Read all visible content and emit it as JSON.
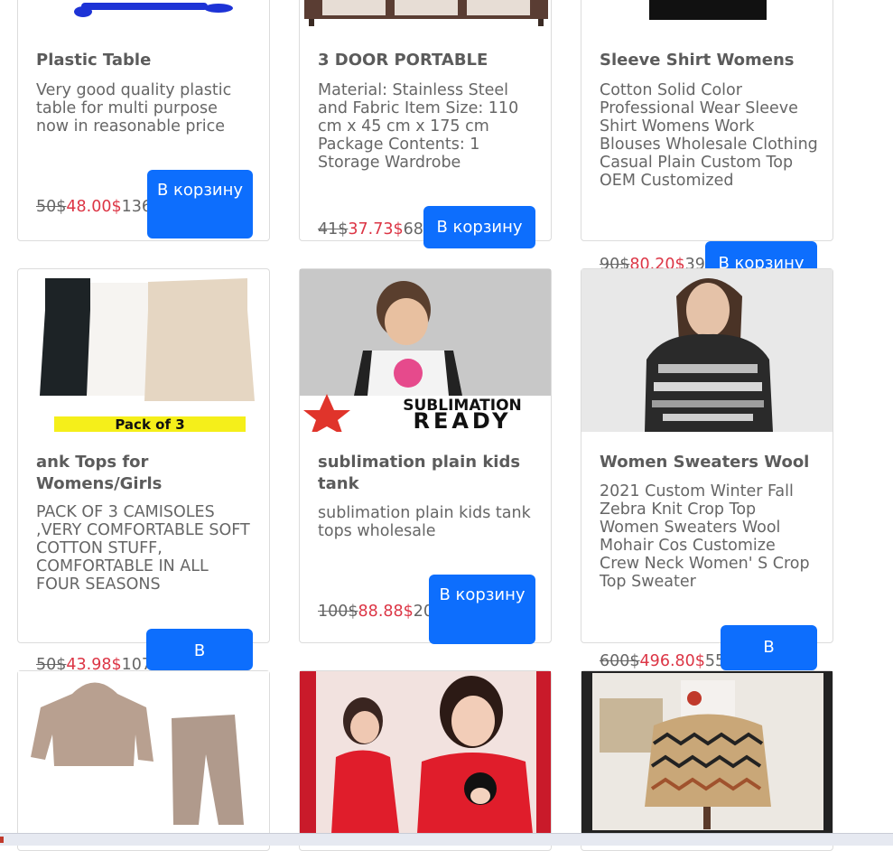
{
  "colors": {
    "accent": "#0d6efd",
    "sale": "#dc3545"
  },
  "products": [
    {
      "title": "Plastic Table",
      "description": "Very good quality plastic table for multi purpose now in reasonable price",
      "old_price": "50$",
      "new_price": "48.00$",
      "qty": "136",
      "button": "В корзину"
    },
    {
      "title": "3 DOOR PORTABLE",
      "description": "Material: Stainless Steel and Fabric Item Size: 110 cm x 45 cm x 175 cm Package Contents: 1 Storage Wardrobe",
      "old_price": "41$",
      "new_price": "37.73$",
      "qty": "68",
      "button": "В корзину"
    },
    {
      "title": "Sleeve Shirt Womens",
      "description": "Cotton Solid Color Professional Wear Sleeve Shirt Womens Work Blouses Wholesale Clothing Casual Plain Custom Top OEM Customized",
      "old_price": "90$",
      "new_price": "80.20$",
      "qty": "39",
      "button": "В корзину"
    },
    {
      "title": "ank Tops for Womens/Girls",
      "description": "PACK OF 3 CAMISOLES ,VERY COMFORTABLE SOFT COTTON STUFF, COMFORTABLE IN ALL FOUR SEASONS",
      "old_price": "50$",
      "new_price": "43.98$",
      "qty": "107",
      "button": "В",
      "image_caption": "Pack of 3"
    },
    {
      "title": "sublimation plain kids tank",
      "description": "sublimation plain kids tank tops wholesale",
      "old_price": "100$",
      "new_price": "88.88$",
      "qty": "20",
      "button": "В корзину",
      "image_caption": "SUBLIMATION",
      "image_caption2": "READY"
    },
    {
      "title": "Women Sweaters Wool",
      "description": "2021 Custom Winter Fall Zebra Knit Crop Top Women Sweaters Wool Mohair Cos Customize Crew Neck Women' S Crop Top Sweater",
      "old_price": "600$",
      "new_price": "496.80$",
      "qty": "55",
      "button": "В"
    }
  ]
}
